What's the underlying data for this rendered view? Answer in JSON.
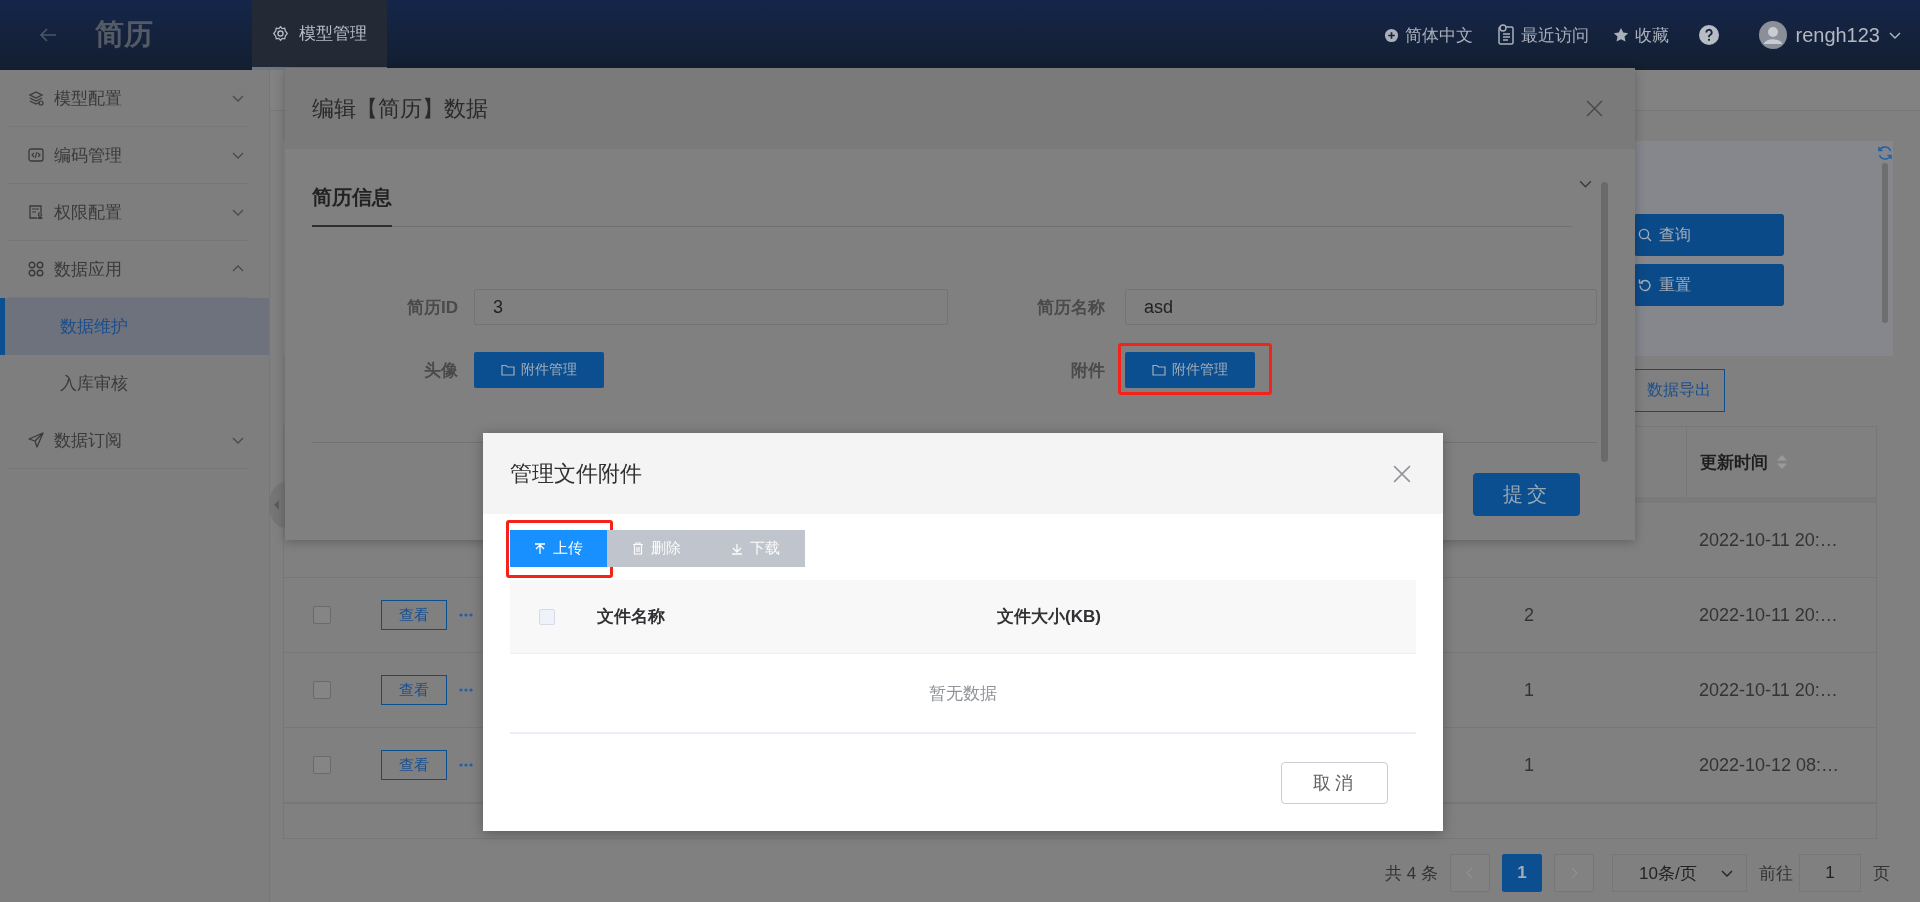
{
  "app": {
    "title": "简历",
    "tab": "模型管理"
  },
  "header_links": [
    {
      "label": "简体中文"
    },
    {
      "label": "最近访问"
    },
    {
      "label": "收藏"
    }
  ],
  "user": {
    "name": "rengh123"
  },
  "sidebar": [
    {
      "label": "模型配置",
      "expanded": false
    },
    {
      "label": "编码管理",
      "expanded": false
    },
    {
      "label": "权限配置",
      "expanded": false
    },
    {
      "label": "数据应用",
      "expanded": true,
      "children": [
        {
          "label": "数据维护",
          "selected": true
        },
        {
          "label": "入库审核",
          "selected": false
        }
      ]
    },
    {
      "label": "数据订阅",
      "expanded": false
    }
  ],
  "search_panel": {
    "buttons": [
      "查询",
      "重置"
    ]
  },
  "toolbar": {
    "buttons": [
      "数据导出"
    ]
  },
  "table": {
    "columns": [
      {
        "label": "更新时间",
        "sortable": true
      }
    ],
    "rows": [
      {
        "updated": "2022-10-11 20:…"
      },
      {
        "checked": false,
        "action": "查看",
        "value": "2",
        "updated": "2022-10-11 20:…"
      },
      {
        "checked": false,
        "action": "查看",
        "value": "1",
        "updated": "2022-10-11 20:…"
      },
      {
        "checked": false,
        "action": "查看",
        "value": "1",
        "updated": "2022-10-12 08:…"
      }
    ]
  },
  "pagination": {
    "total": "共 4 条",
    "prev_disabled": true,
    "pages": [
      {
        "label": "1",
        "selected": true
      }
    ],
    "next_disabled": true,
    "page_size": "10条/页",
    "goto_label": "前往",
    "goto_value": "1",
    "goto_unit": "页"
  },
  "edit_dialog": {
    "title": "编辑【简历】数据",
    "section": {
      "title": "简历信息",
      "expanded": true
    },
    "fields": [
      {
        "kind": "input",
        "label": "简历ID",
        "value": "3"
      },
      {
        "kind": "input",
        "label": "简历名称",
        "value": "asd"
      },
      {
        "kind": "attachment",
        "label": "头像",
        "button": "附件管理",
        "highlighted": false
      },
      {
        "kind": "attachment",
        "label": "附件",
        "button": "附件管理",
        "highlighted": true
      }
    ],
    "buttons": [
      "提交"
    ]
  },
  "file_dialog": {
    "title": "管理文件附件",
    "toolbar": [
      {
        "label": "上传",
        "disabled": false,
        "highlighted": true
      },
      {
        "label": "删除",
        "disabled": true,
        "highlighted": false
      },
      {
        "label": "下载",
        "disabled": true,
        "highlighted": false
      }
    ],
    "select_all": {
      "checked": false
    },
    "columns": [
      "文件名称",
      "文件大小(KB)"
    ],
    "empty_text": "暂无数据",
    "buttons": [
      "取消"
    ]
  }
}
